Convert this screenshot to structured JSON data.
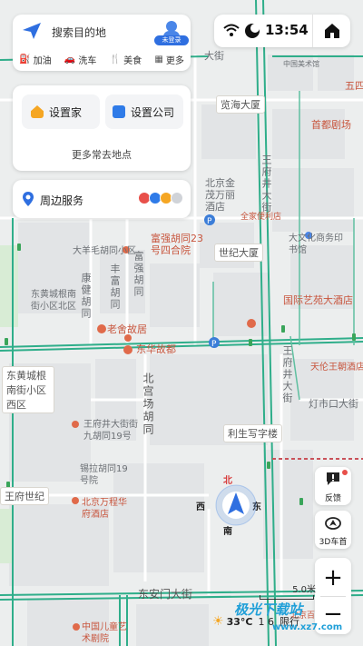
{
  "search": {
    "placeholder": "搜索目的地",
    "avatar_badge": "未登录"
  },
  "quick_actions": [
    {
      "label": "加油",
      "icon": "gas-icon"
    },
    {
      "label": "洗车",
      "icon": "car-wash-icon"
    },
    {
      "label": "美食",
      "icon": "food-icon"
    },
    {
      "label": "更多",
      "icon": "grid-icon"
    }
  ],
  "places": {
    "home": "设置家",
    "company": "设置公司",
    "more": "更多常去地点"
  },
  "nearby": {
    "label": "周边服务"
  },
  "status": {
    "time": "13:54"
  },
  "side_buttons": {
    "feedback": "反馈",
    "view": "3D车首",
    "zoom_in": "+",
    "zoom_out": "−"
  },
  "compass": {
    "north": "北",
    "south": "南",
    "west": "西",
    "east": "东"
  },
  "scale": "5.0米",
  "weather": {
    "temp": "33°C",
    "restriction_digits": "1 6",
    "restriction": "限行"
  },
  "watermark": {
    "main": "极光下载站",
    "sub": "www.xz7.com"
  },
  "map_labels": [
    {
      "text": "大街",
      "kind": ""
    },
    {
      "text": "中国美术馆",
      "kind": ""
    },
    {
      "text": "五四",
      "kind": "poi"
    },
    {
      "text": "览海大厦",
      "kind": ""
    },
    {
      "text": "首都剧场",
      "kind": "poi"
    },
    {
      "text": "北京金茂万丽酒店",
      "kind": ""
    },
    {
      "text": "全家便利店",
      "kind": "poi"
    },
    {
      "text": "王府井大街",
      "kind": ""
    },
    {
      "text": "富强胡同23号四合院",
      "kind": "poi"
    },
    {
      "text": "大羊毛胡同小区",
      "kind": ""
    },
    {
      "text": "世纪大厦",
      "kind": ""
    },
    {
      "text": "大文化商务印书馆",
      "kind": ""
    },
    {
      "text": "东黄城根南街小区北区",
      "kind": ""
    },
    {
      "text": "康健胡同",
      "kind": ""
    },
    {
      "text": "丰富胡同",
      "kind": ""
    },
    {
      "text": "富强胡同",
      "kind": ""
    },
    {
      "text": "老舍故居",
      "kind": "poi"
    },
    {
      "text": "国际艺苑大酒店",
      "kind": "poi"
    },
    {
      "text": "东华故都",
      "kind": "poi"
    },
    {
      "text": "东黄城根南街小区西区",
      "kind": ""
    },
    {
      "text": "天伦王朝酒店",
      "kind": "poi"
    },
    {
      "text": "王府井大街",
      "kind": ""
    },
    {
      "text": "北宫场胡同",
      "kind": ""
    },
    {
      "text": "灯市口大街",
      "kind": ""
    },
    {
      "text": "王府井大街街九胡同19号",
      "kind": ""
    },
    {
      "text": "利生写字楼",
      "kind": ""
    },
    {
      "text": "锡拉胡同19号院",
      "kind": ""
    },
    {
      "text": "王府世纪",
      "kind": ""
    },
    {
      "text": "北京万程华府酒店",
      "kind": "poi"
    },
    {
      "text": "东安门大街",
      "kind": ""
    },
    {
      "text": "中国儿童艺术剧院",
      "kind": "poi"
    },
    {
      "text": "北京百货大楼",
      "kind": "poi"
    }
  ]
}
